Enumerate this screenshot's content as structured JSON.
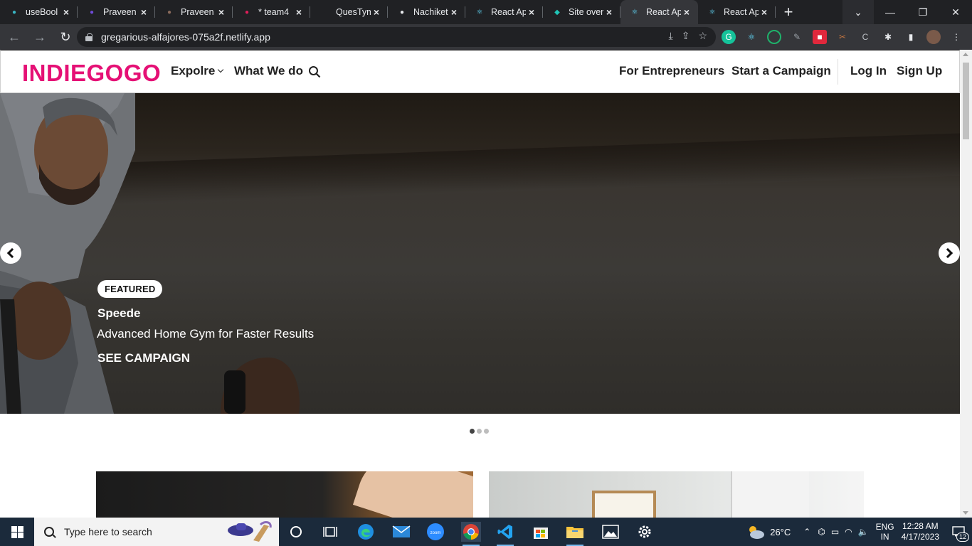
{
  "browser": {
    "tabs": [
      {
        "title": "useBool",
        "favicon": "bolt-icon",
        "color": "#39b6c4",
        "active": false
      },
      {
        "title": "Praveen",
        "favicon": "pokemon-icon",
        "color": "#6f4bd8",
        "active": false
      },
      {
        "title": "Praveen",
        "favicon": "avatar-icon",
        "color": "#8a6b5c",
        "active": false
      },
      {
        "title": "* team4",
        "favicon": "slack-icon",
        "color": "#e01e5a",
        "active": false
      },
      {
        "title": "QuesTym",
        "favicon": "dash-icon",
        "color": "#202124",
        "active": false
      },
      {
        "title": "Nachiket",
        "favicon": "github-icon",
        "color": "#e8eaed",
        "active": false
      },
      {
        "title": "React Ap",
        "favicon": "react-icon",
        "color": "#61dafb",
        "active": false
      },
      {
        "title": "Site over",
        "favicon": "netlify-icon",
        "color": "#20c6b7",
        "active": false
      },
      {
        "title": "React Ap",
        "favicon": "react-icon",
        "color": "#61dafb",
        "active": true
      },
      {
        "title": "React Ap",
        "favicon": "react-icon",
        "color": "#61dafb",
        "active": false
      }
    ],
    "url": "gregarious-alfajores-075a2f.netlify.app"
  },
  "site": {
    "brand_color": "#e51075",
    "logo": "INDIEGOGO",
    "nav": {
      "explore": "Expolre",
      "what_we_do": "What We do",
      "for_entrepreneurs": "For Entrepreneurs",
      "start_campaign": "Start a Campaign",
      "log_in": "Log In",
      "sign_up": "Sign Up"
    },
    "hero": {
      "badge": "FEATURED",
      "campaign_name": "Speede",
      "campaign_desc": "Advanced Home Gym for Faster Results",
      "cta": "SEE CAMPAIGN"
    },
    "carousel": {
      "total": 3,
      "active_index": 0
    }
  },
  "taskbar": {
    "search_placeholder": "Type here to search",
    "weather": "26°C",
    "language_top": "ENG",
    "language_bottom": "IN",
    "time": "12:28 AM",
    "date": "4/17/2023",
    "notification_count": "12"
  }
}
